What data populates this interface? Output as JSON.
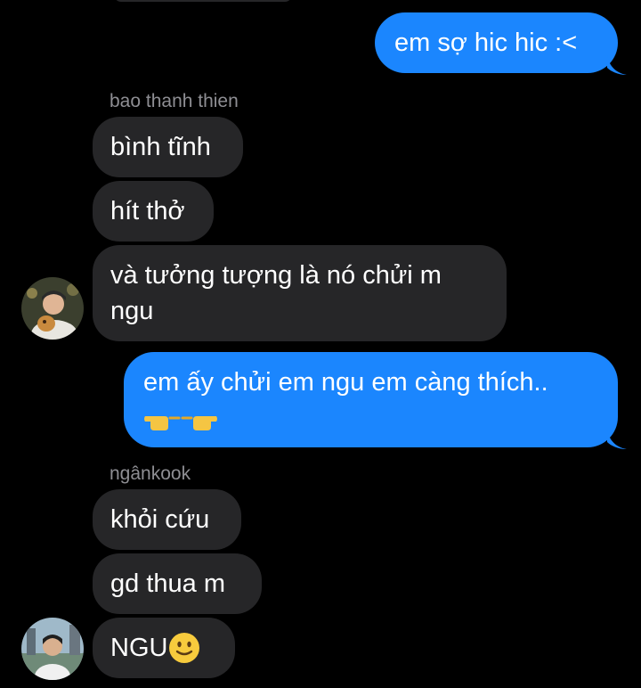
{
  "messages": [
    {
      "direction": "outgoing",
      "text": "em sợ hic hic :<"
    },
    {
      "sender": "bao thanh thien"
    },
    {
      "direction": "incoming",
      "text": "bình tĩnh"
    },
    {
      "direction": "incoming",
      "text": "hít thở"
    },
    {
      "direction": "incoming",
      "lines": [
        "và tưởng tượng là nó chửi m",
        "ngu"
      ]
    },
    {
      "direction": "outgoing",
      "text": "em ấy chửi em ngu em càng thích..",
      "emoji": "backhand-pointing-hands"
    },
    {
      "sender": "ngânkook"
    },
    {
      "direction": "incoming",
      "text": "khỏi cứu"
    },
    {
      "direction": "incoming",
      "text": "gd thua m"
    },
    {
      "direction": "incoming",
      "text": "NGU",
      "emoji": "slightly-smiling-face"
    }
  ],
  "colors": {
    "background": "#000000",
    "incoming_bubble": "#262628",
    "outgoing_bubble": "#1b86fe",
    "sender_name": "#8e8e93",
    "text": "#ffffff"
  }
}
